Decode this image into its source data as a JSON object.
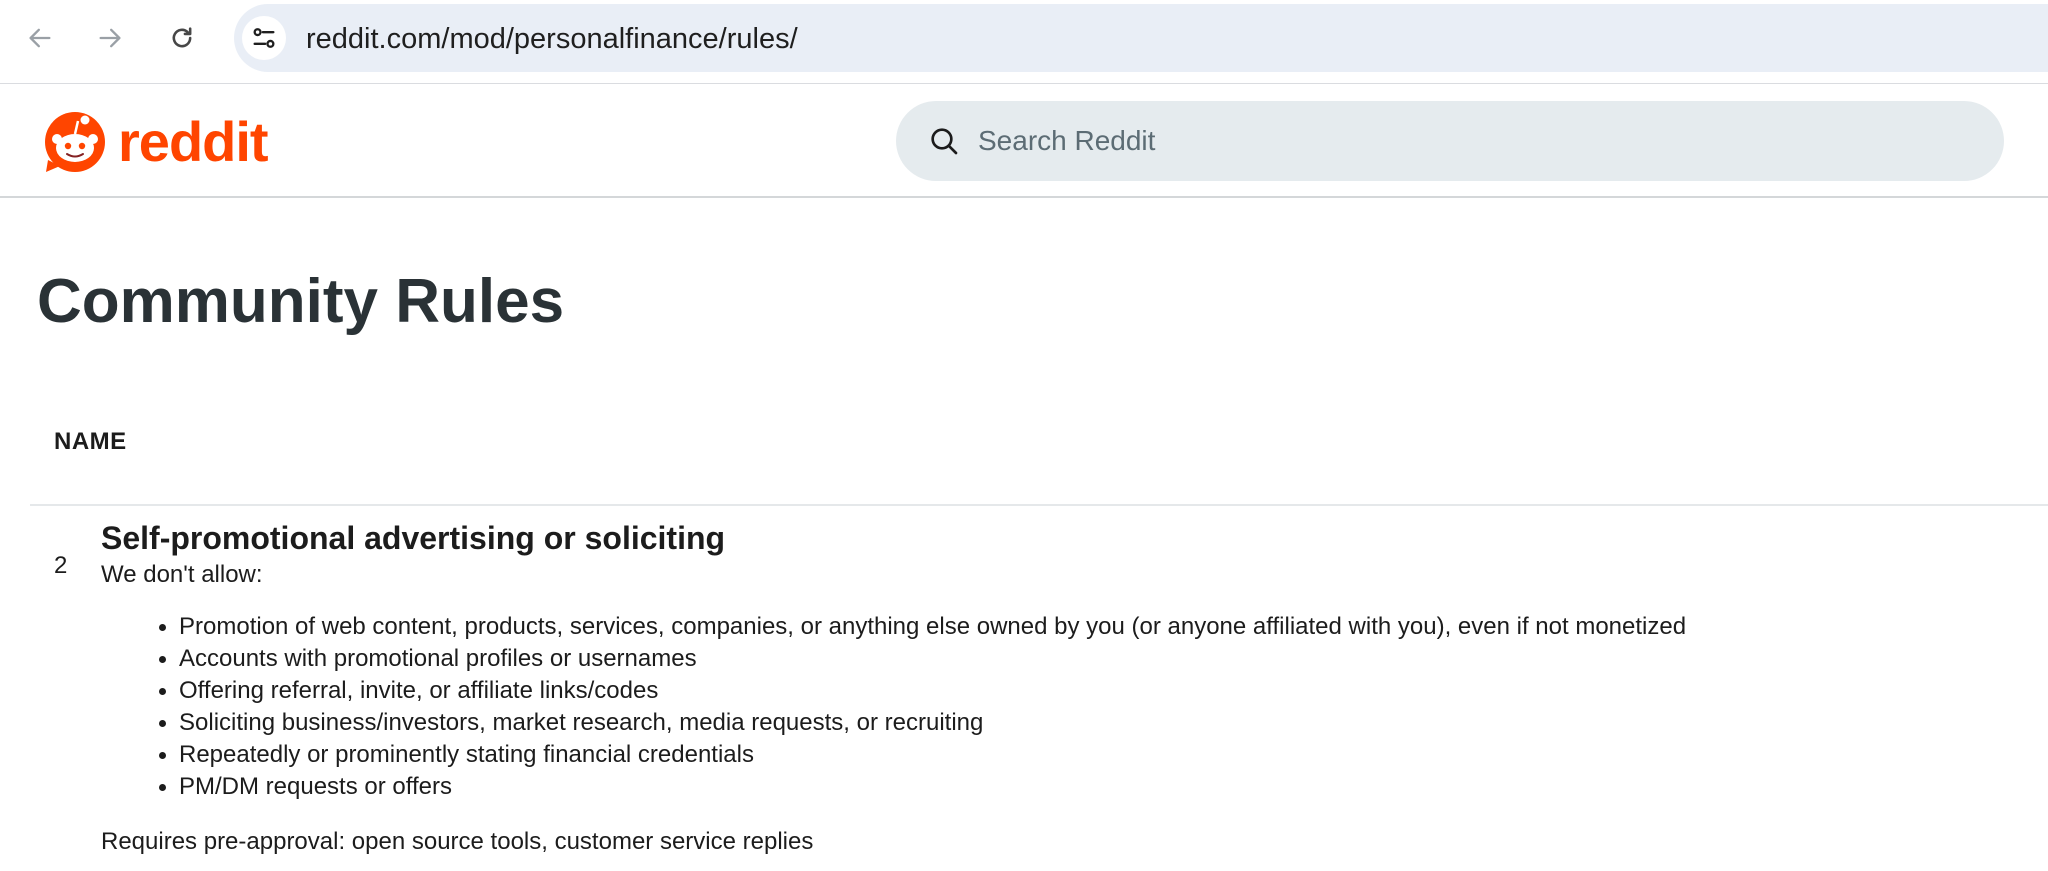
{
  "browser": {
    "url": "reddit.com/mod/personalfinance/rules/"
  },
  "header": {
    "logo_text": "reddit",
    "search_placeholder": "Search Reddit"
  },
  "page": {
    "title": "Community Rules",
    "column_header": "NAME"
  },
  "rule": {
    "number": "2",
    "title": "Self-promotional advertising or soliciting",
    "intro": "We don't allow:",
    "items": [
      "Promotion of web content, products, services, companies, or anything else owned by you (or anyone affiliated with you), even if not monetized",
      "Accounts with promotional profiles or usernames",
      "Offering referral, invite, or affiliate links/codes",
      "Soliciting business/investors, market research, media requests, or recruiting",
      "Repeatedly or prominently stating financial credentials",
      "PM/DM requests or offers"
    ],
    "footer": "Requires pre-approval: open source tools, customer service replies"
  },
  "colors": {
    "brand": "#ff4500",
    "omnibox_bg": "#e9eef6",
    "search_bg": "#e5ebee",
    "title_text": "#2a3236"
  },
  "icons": [
    "back-arrow-icon",
    "forward-arrow-icon",
    "reload-icon",
    "site-settings-icon",
    "reddit-snoo-icon",
    "search-icon"
  ]
}
